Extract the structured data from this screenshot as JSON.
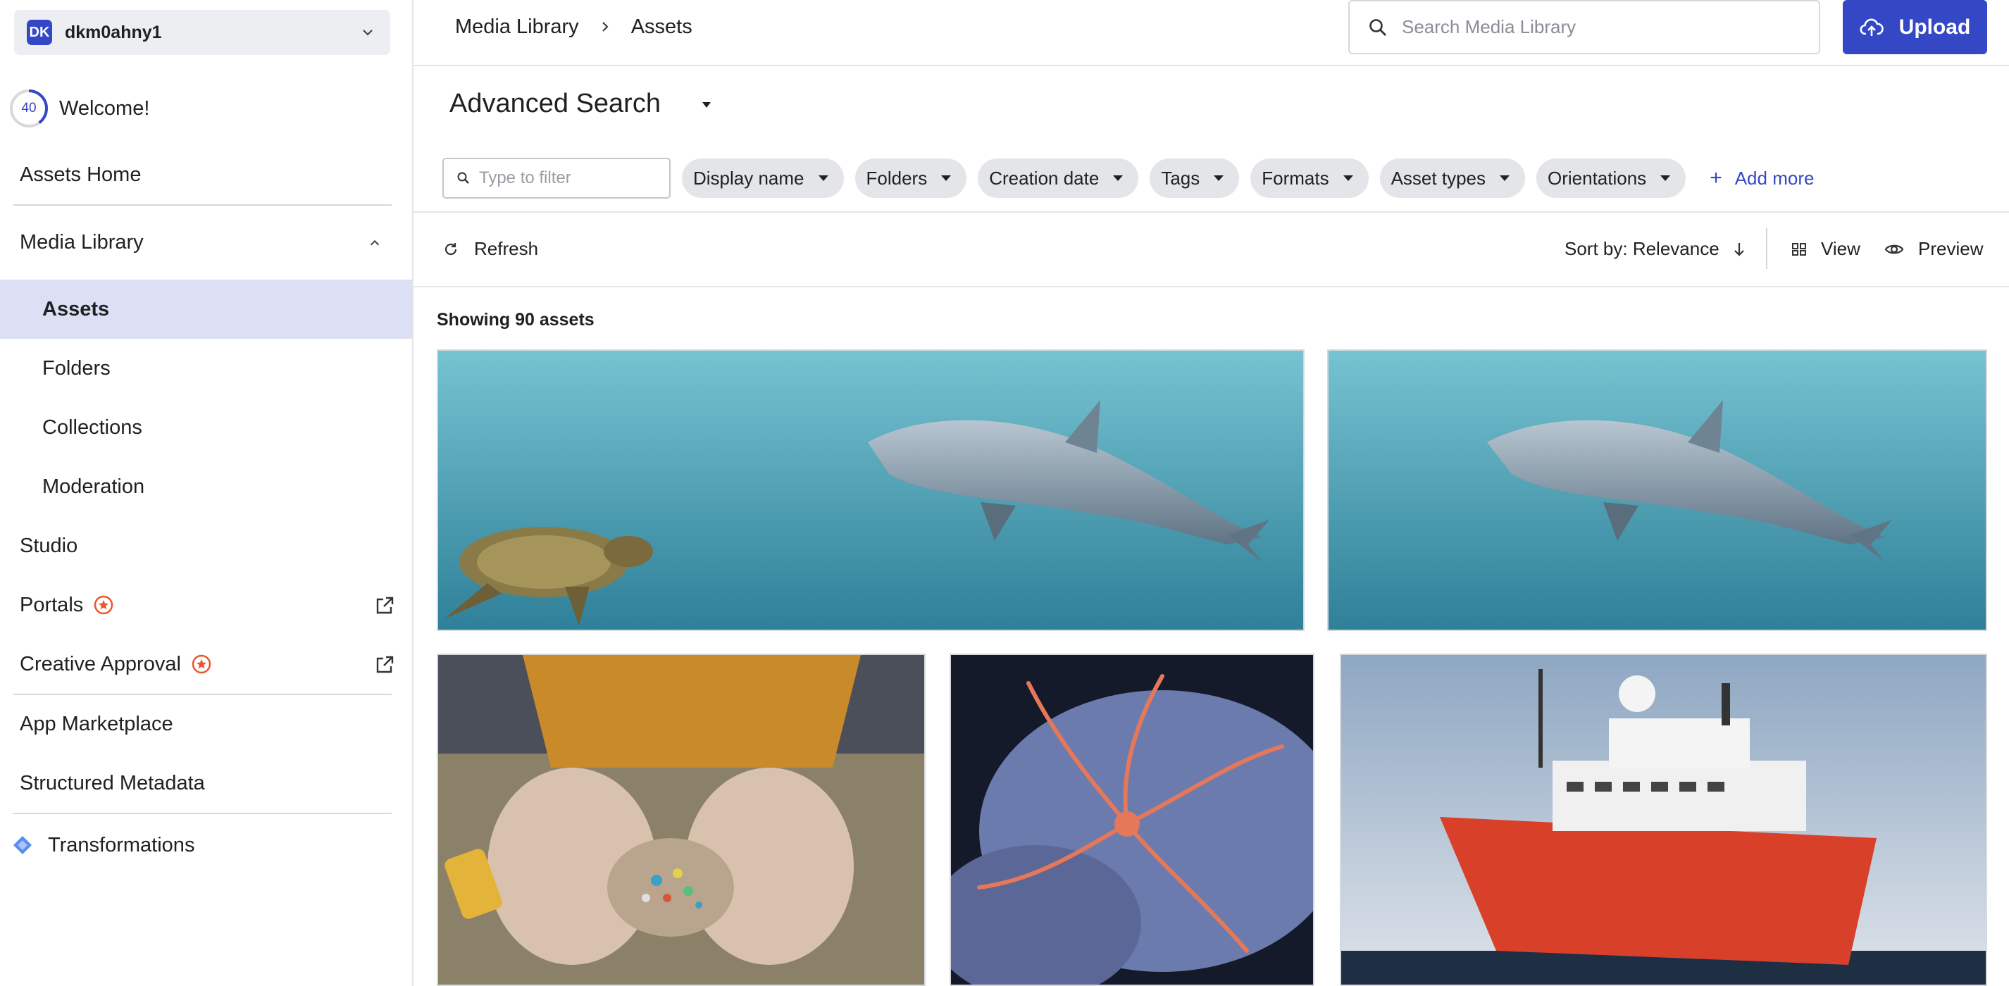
{
  "account": {
    "initials": "DK",
    "name": "dkm0ahny1"
  },
  "welcome": {
    "progress": 40,
    "progress_label": "40",
    "label": "Welcome!"
  },
  "sidebar": {
    "items": [
      {
        "label": "Assets Home"
      },
      {
        "label": "Media Library"
      },
      {
        "label": "Assets"
      },
      {
        "label": "Folders"
      },
      {
        "label": "Collections"
      },
      {
        "label": "Moderation"
      },
      {
        "label": "Studio"
      },
      {
        "label": "Portals"
      },
      {
        "label": "Creative Approval"
      },
      {
        "label": "App Marketplace"
      },
      {
        "label": "Structured Metadata"
      },
      {
        "label": "Transformations"
      }
    ],
    "active_item": "Assets"
  },
  "breadcrumb": {
    "root": "Media Library",
    "current": "Assets"
  },
  "search": {
    "placeholder": "Search Media Library",
    "value": ""
  },
  "upload": {
    "label": "Upload"
  },
  "advanced_search": {
    "title": "Advanced Search"
  },
  "filters": {
    "filter_placeholder": "Type to filter",
    "chips": [
      "Display name",
      "Folders",
      "Creation date",
      "Tags",
      "Formats",
      "Asset types",
      "Orientations"
    ],
    "add_more": "Add more"
  },
  "toolbar": {
    "refresh": "Refresh",
    "sort": "Sort by: Relevance",
    "view": "View",
    "preview": "Preview"
  },
  "results": {
    "showing": "Showing 90 assets"
  },
  "assets": [
    {
      "kind": "image",
      "subject": "dolphin-and-turtle"
    },
    {
      "kind": "image",
      "subject": "dolphin"
    },
    {
      "kind": "image",
      "subject": "hands-with-microplastics"
    },
    {
      "kind": "image",
      "subject": "brittle-star"
    },
    {
      "kind": "image",
      "subject": "research-ship"
    }
  ],
  "colors": {
    "accent": "#3448c5",
    "active_bg": "#dde0f4",
    "chip_bg": "#e4e5e9",
    "badge": "#e8562a"
  }
}
